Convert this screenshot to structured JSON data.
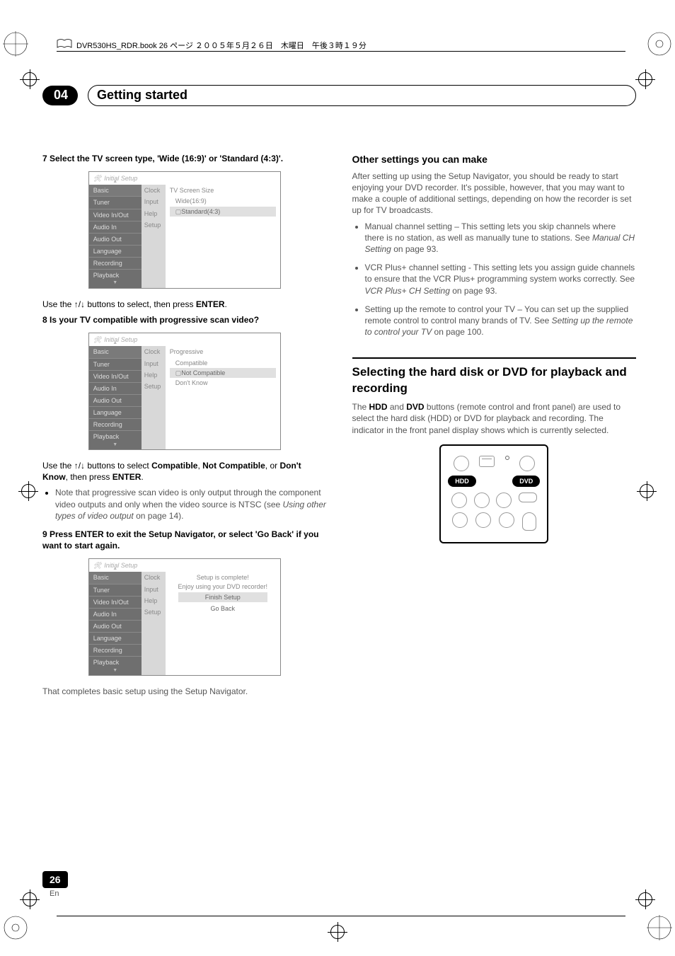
{
  "meta": {
    "header_text": "DVR530HS_RDR.book  26 ページ  ２００５年５月２６日　木曜日　午後３時１９分"
  },
  "chapter": {
    "number": "04",
    "title": "Getting started"
  },
  "left": {
    "step7_head": "7    Select the TV screen type, 'Wide (16:9)' or 'Standard (4:3)'.",
    "use1_a": "Use the ",
    "use1_b": " buttons to select, then press ",
    "enter": "ENTER",
    "step8_head": "8    Is your TV compatible with progressive scan video?",
    "use2_a": "Use the ",
    "use2_b": " buttons to select ",
    "compatible": "Compatible",
    "notcomp": "Not Compatible",
    "or": ", or ",
    "dontknow": "Don't Know",
    "thenpress": ", then press ",
    "bullet1_a": "Note that progressive scan video is only output through the component video outputs and only when the video source is NTSC (see ",
    "bullet1_i": "Using other types of video output",
    "bullet1_b": " on page 14).",
    "step9_head": "9    Press ENTER to exit the Setup Navigator, or select 'Go Back' if you want to start again.",
    "closing": "That completes basic setup using the Setup Navigator."
  },
  "right": {
    "subhead": "Other settings you can make",
    "intro": "After setting up using the Setup Navigator, you should be ready to start enjoying your DVD recorder. It's possible, however, that you may want to make a couple of additional settings, depending on how the recorder is set up for  TV broadcasts.",
    "b1_a": "Manual channel setting – This setting lets you skip channels where there is no station, as well as manually tune to stations. See ",
    "b1_i": "Manual CH Setting",
    "b1_b": " on page 93.",
    "b2_a": "VCR Plus+ channel setting - This setting lets you assign guide channels to ensure that the VCR Plus+ programming system works correctly. See ",
    "b2_i": "VCR Plus+ CH Setting",
    "b2_b": " on page 93.",
    "b3_a": "Setting up the remote to control your TV – You can set up the supplied remote control to control many brands of TV. See ",
    "b3_i": "Setting up the remote to control your TV",
    "b3_b": " on page 100.",
    "section_title": "Selecting the hard disk or DVD for playback and recording",
    "section_body_a": "The ",
    "hdd": "HDD",
    "and": " and ",
    "dvd": "DVD",
    "section_body_b": " buttons (remote control and front panel) are used to select the hard disk (HDD) or DVD for playback and recording. The indicator in the front panel display shows which is currently selected.",
    "remote_hdd": "HDD",
    "remote_dvd": "DVD"
  },
  "osd_common": {
    "title": "Initial Setup",
    "side": [
      "Basic",
      "Tuner",
      "Video In/Out",
      "Audio In",
      "Audio Out",
      "Language",
      "Recording",
      "Playback"
    ],
    "mid": [
      "Clock",
      "Input",
      "Help",
      "Setup"
    ]
  },
  "osd1": {
    "heading": "TV Screen Size",
    "opt1": "Wide(16:9)",
    "opt2": "Standard(4:3)"
  },
  "osd2": {
    "heading": "Progressive",
    "opt1": "Compatible",
    "opt2": "Not Compatible",
    "opt3": "Don't Know"
  },
  "osd3": {
    "msg1": "Setup is complete!",
    "msg2": "Enjoy using your DVD recorder!",
    "btn1": "Finish Setup",
    "btn2": "Go Back"
  },
  "page": {
    "num": "26",
    "lang": "En"
  }
}
